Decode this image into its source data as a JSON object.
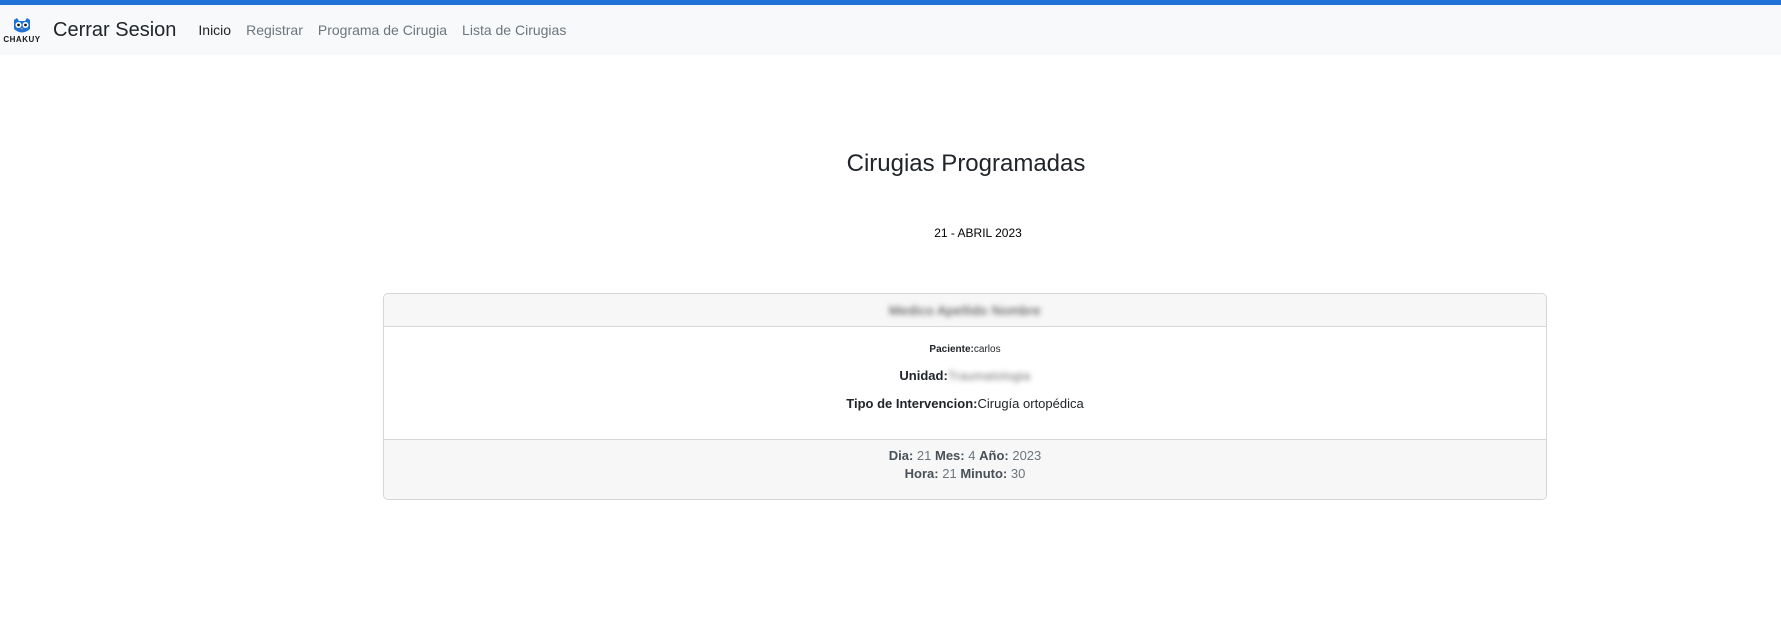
{
  "navbar": {
    "logo_text": "CHAKUY",
    "brand": "Cerrar Sesion",
    "links": [
      {
        "label": "Inicio"
      },
      {
        "label": "Registrar"
      },
      {
        "label": "Programa de Cirugia"
      },
      {
        "label": "Lista de Cirugias"
      }
    ]
  },
  "main": {
    "title": "Cirugias Programadas",
    "date": "21 - ABRIL 2023"
  },
  "card": {
    "header": "Medico Apellido Nombre",
    "paciente_label": "Paciente:",
    "paciente_value": "carlos",
    "unidad_label": "Unidad:",
    "unidad_value": "Traumatologia",
    "tipo_label": "Tipo de Intervencion:",
    "tipo_value": "Cirugía ortopédica",
    "dia_label": "Dia:",
    "dia_value": "21",
    "mes_label": "Mes:",
    "mes_value": "4",
    "anio_label": "Año:",
    "anio_value": "2023",
    "hora_label": "Hora:",
    "hora_value": "21",
    "minuto_label": "Minuto:",
    "minuto_value": "30"
  },
  "colors": {
    "accent": "#1f73d6",
    "navbar_bg": "#f8f9fa",
    "card_header_bg": "#f7f7f7"
  }
}
